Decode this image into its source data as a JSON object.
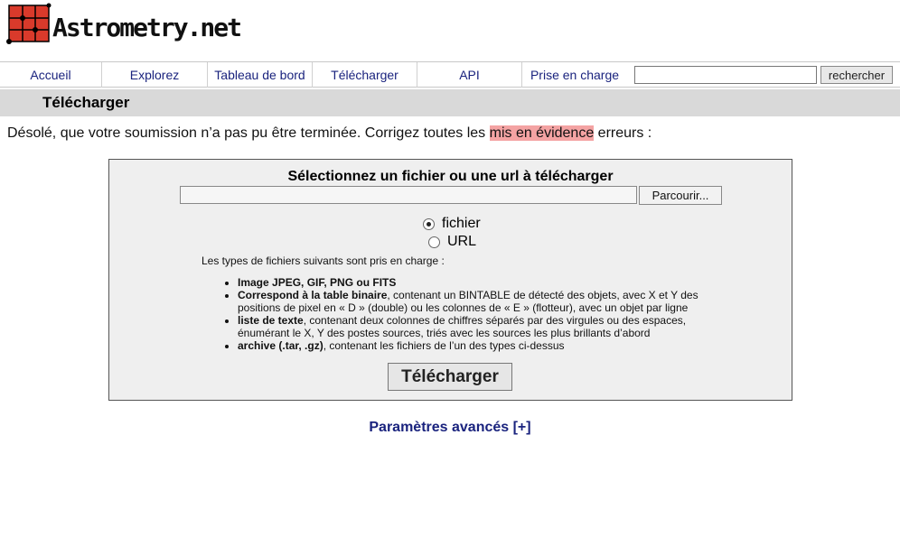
{
  "header": {
    "logo_text": "Astrometry.net",
    "logo_color": "#d93a2b"
  },
  "nav": {
    "items": [
      {
        "label": "Accueil"
      },
      {
        "label": "Explorez"
      },
      {
        "label": "Tableau de bord"
      },
      {
        "label": "Télécharger"
      },
      {
        "label": "API"
      },
      {
        "label": "Prise en charge"
      }
    ],
    "search_value": "",
    "search_button": "rechercher"
  },
  "page": {
    "title": "Télécharger",
    "error_before": "Désolé, que votre soumission n’a pas pu être terminée. Corrigez toutes les ",
    "error_highlight": "mis en évidence",
    "error_after": " erreurs :"
  },
  "upload": {
    "heading": "Sélectionnez un fichier ou une url à télécharger",
    "browse_button": "Parcourir...",
    "options": [
      {
        "label": "fichier",
        "selected": true
      },
      {
        "label": "URL",
        "selected": false
      }
    ],
    "types_intro": "Les types de fichiers suivants sont pris en charge :",
    "types": [
      {
        "bold": "Image JPEG, GIF, PNG ou FITS",
        "text": ""
      },
      {
        "bold": "Correspond à la table binaire",
        "text": ", contenant un BINTABLE de détecté des objets, avec X et Y des positions de pixel en « D » (double) ou les colonnes de « E » (flotteur), avec un objet par ligne"
      },
      {
        "bold": "liste de texte",
        "text": ", contenant deux colonnes de chiffres séparés par des virgules ou des espaces, énumérant le X, Y des postes sources, triés avec les sources les plus brillants d’abord"
      },
      {
        "bold": "archive (.tar, .gz)",
        "text": ", contenant les fichiers de l’un des types ci-dessus"
      }
    ],
    "submit_button": "Télécharger"
  },
  "advanced": {
    "label": "Paramètres avancés [+]"
  }
}
